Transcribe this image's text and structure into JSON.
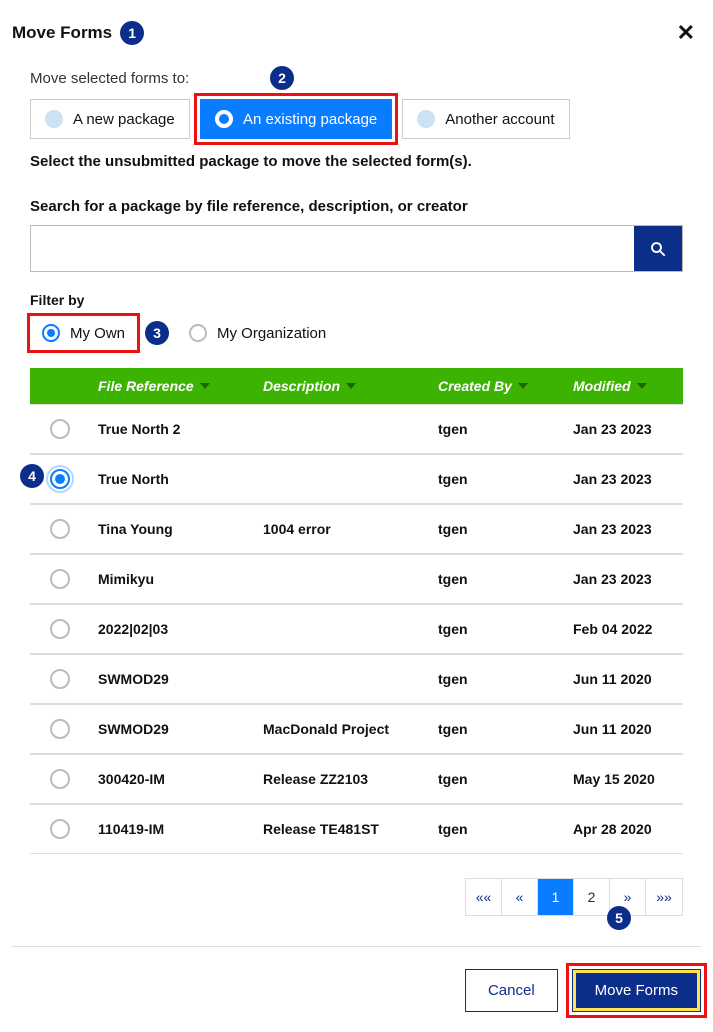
{
  "title": "Move Forms",
  "annotations": {
    "a1": "1",
    "a2": "2",
    "a3": "3",
    "a4": "4",
    "a5": "5"
  },
  "subheading": "Move selected forms to:",
  "dest_options": {
    "new_package": "A new package",
    "existing_package": "An existing package",
    "another_account": "Another account"
  },
  "instruction": "Select the unsubmitted package to move the selected form(s).",
  "search_label": "Search for a package by file reference, description, or creator",
  "search": {
    "value": "",
    "placeholder": ""
  },
  "filter": {
    "label": "Filter by",
    "my_own": "My Own",
    "my_org": "My Organization"
  },
  "columns": {
    "file_ref": "File Reference",
    "description": "Description",
    "created_by": "Created By",
    "modified": "Modified"
  },
  "rows": [
    {
      "ref": "True North 2",
      "desc": "",
      "by": "tgen",
      "mod": "Jan 23 2023",
      "selected": false
    },
    {
      "ref": "True North",
      "desc": "",
      "by": "tgen",
      "mod": "Jan 23 2023",
      "selected": true
    },
    {
      "ref": "Tina Young",
      "desc": "1004 error",
      "by": "tgen",
      "mod": "Jan 23 2023",
      "selected": false
    },
    {
      "ref": "Mimikyu",
      "desc": "",
      "by": "tgen",
      "mod": "Jan 23 2023",
      "selected": false
    },
    {
      "ref": "2022|02|03",
      "desc": "",
      "by": "tgen",
      "mod": "Feb 04 2022",
      "selected": false
    },
    {
      "ref": "SWMOD29",
      "desc": "",
      "by": "tgen",
      "mod": "Jun 11 2020",
      "selected": false
    },
    {
      "ref": "SWMOD29",
      "desc": "MacDonald Project",
      "by": "tgen",
      "mod": "Jun 11 2020",
      "selected": false
    },
    {
      "ref": "300420-IM",
      "desc": "Release ZZ2103",
      "by": "tgen",
      "mod": "May 15 2020",
      "selected": false
    },
    {
      "ref": "110419-IM",
      "desc": "Release TE481ST",
      "by": "tgen",
      "mod": "Apr 28 2020",
      "selected": false
    }
  ],
  "pager": {
    "first": "««",
    "prev": "«",
    "p1": "1",
    "p2": "2",
    "next": "»",
    "last": "»»"
  },
  "footer": {
    "cancel": "Cancel",
    "move": "Move Forms"
  }
}
